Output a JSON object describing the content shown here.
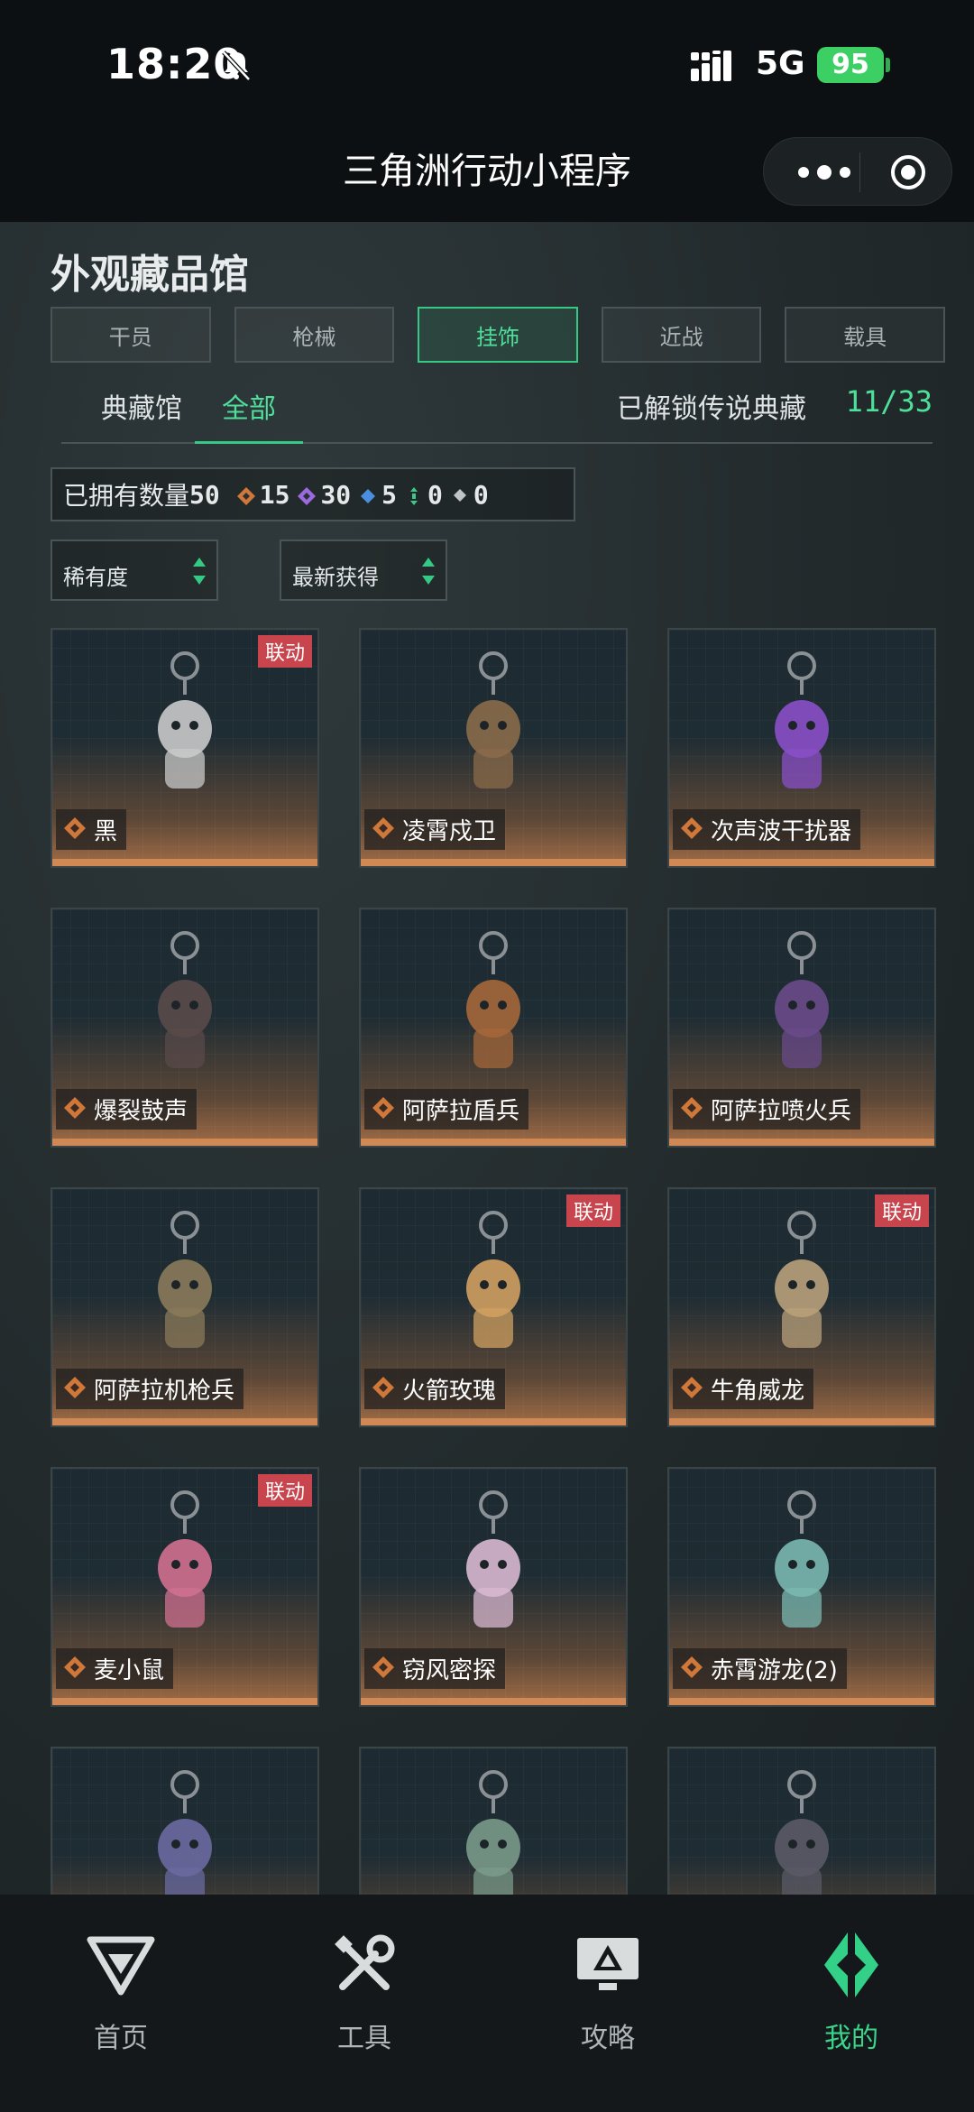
{
  "status_bar": {
    "time": "18:20",
    "network": "5G",
    "battery": "95"
  },
  "app_title": "三角洲行动小程序",
  "page": {
    "heading": "外观藏品馆",
    "category_tabs": [
      {
        "label": "干员",
        "active": false
      },
      {
        "label": "枪械",
        "active": false
      },
      {
        "label": "挂饰",
        "active": true
      },
      {
        "label": "近战",
        "active": false
      },
      {
        "label": "载具",
        "active": false
      }
    ],
    "sub_tabs": [
      {
        "label": "典藏馆",
        "active": false
      },
      {
        "label": "全部",
        "active": true
      }
    ],
    "legend_label": "已解锁传说典藏",
    "legend_count": "11/33",
    "owned": {
      "label": "已拥有数量",
      "total": "50",
      "counts": [
        {
          "color": "#d0773a",
          "value": "15"
        },
        {
          "color": "#9b6ae0",
          "value": "30"
        },
        {
          "color": "#4a8fe0",
          "value": "5"
        },
        {
          "color": "#3ec98a",
          "value": "0"
        },
        {
          "color": "#c0c4c6",
          "value": "0"
        }
      ]
    },
    "filters": {
      "rarity": "稀有度",
      "sort": "最新获得"
    }
  },
  "items": [
    {
      "name": "黑",
      "badge": "联动"
    },
    {
      "name": "凌霄戍卫",
      "badge": ""
    },
    {
      "name": "次声波干扰器",
      "badge": ""
    },
    {
      "name": "爆裂鼓声",
      "badge": ""
    },
    {
      "name": "阿萨拉盾兵",
      "badge": ""
    },
    {
      "name": "阿萨拉喷火兵",
      "badge": ""
    },
    {
      "name": "阿萨拉机枪兵",
      "badge": ""
    },
    {
      "name": "火箭玫瑰",
      "badge": "联动"
    },
    {
      "name": "牛角威龙",
      "badge": "联动"
    },
    {
      "name": "麦小鼠",
      "badge": "联动"
    },
    {
      "name": "窃风密探",
      "badge": ""
    },
    {
      "name": "赤霄游龙(2)",
      "badge": ""
    },
    {
      "name": "",
      "badge": ""
    },
    {
      "name": "",
      "badge": ""
    },
    {
      "name": "",
      "badge": ""
    }
  ],
  "bottom_nav": [
    {
      "label": "首页",
      "icon": "home-logo-icon",
      "active": false
    },
    {
      "label": "工具",
      "icon": "tools-icon",
      "active": false
    },
    {
      "label": "攻略",
      "icon": "guide-monitor-icon",
      "active": false
    },
    {
      "label": "我的",
      "icon": "profile-logo-icon",
      "active": true
    }
  ]
}
